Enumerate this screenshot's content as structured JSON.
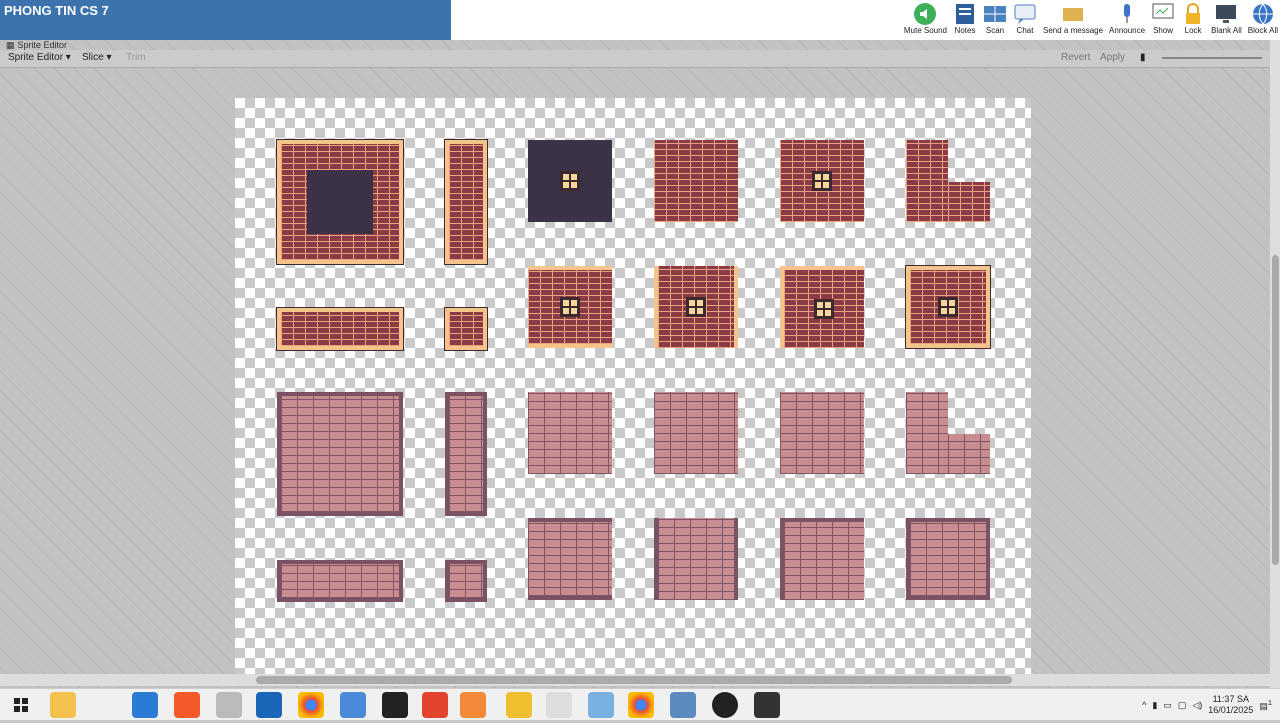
{
  "title": "PHONG TIN CS 7",
  "tools": [
    {
      "label": "Mute Sound",
      "icon": "speaker-icon"
    },
    {
      "label": "Notes",
      "icon": "notes-icon"
    },
    {
      "label": "Scan",
      "icon": "scan-icon"
    },
    {
      "label": "Chat",
      "icon": "chat-icon"
    },
    {
      "label": "Send a message",
      "icon": "envelope-icon"
    },
    {
      "label": "Announce",
      "icon": "microphone-icon"
    },
    {
      "label": "Show",
      "icon": "presentation-icon"
    },
    {
      "label": "Lock",
      "icon": "lock-icon"
    },
    {
      "label": "Blank All",
      "icon": "monitor-icon"
    },
    {
      "label": "Block All",
      "icon": "globe-icon"
    }
  ],
  "editor": {
    "tab": "Sprite Editor",
    "menu": "Sprite Editor",
    "slice": "Slice",
    "trim": "Trim",
    "revert": "Revert",
    "apply": "Apply"
  },
  "clock": {
    "time": "11:37 SA",
    "date": "16/01/2025"
  },
  "notification_count": "1"
}
